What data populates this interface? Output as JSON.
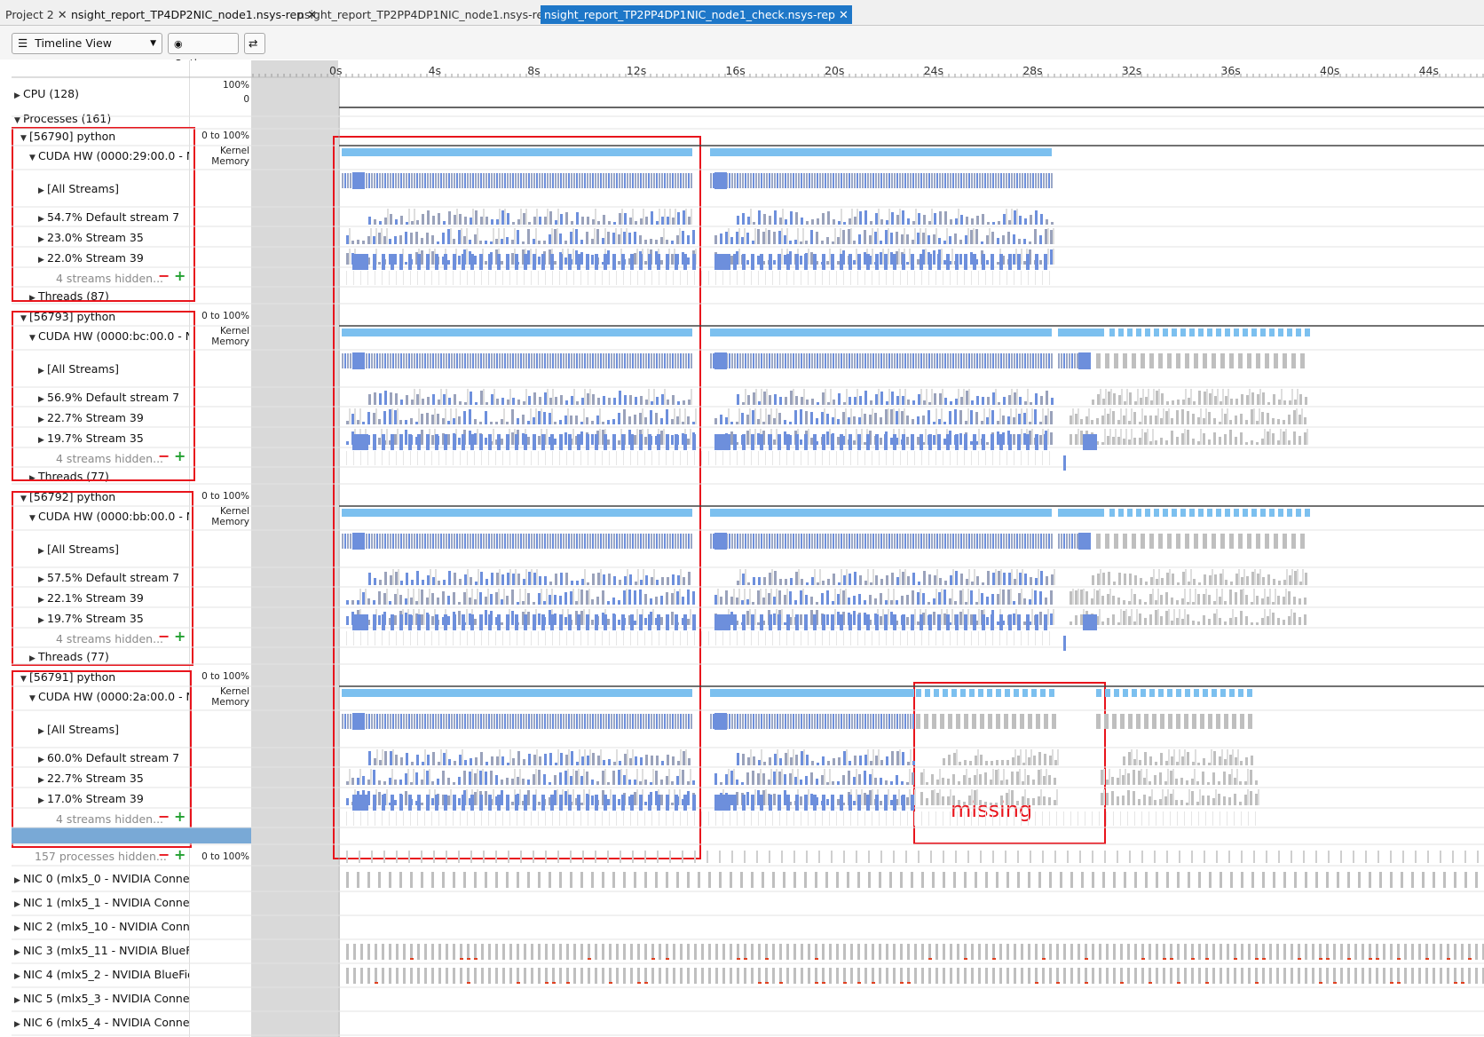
{
  "tabs": [
    {
      "label": "Project 2",
      "active": false
    },
    {
      "label": "nsight_report_TP4DP2NIC_node1.nsys-rep",
      "active": false
    },
    {
      "label": "nsight_report_TP2PP4DP1NIC_node1.nsys-rep",
      "active": false
    },
    {
      "label": "nsight_report_TP2PP4DP1NIC_node1_check.nsys-rep",
      "active": true
    }
  ],
  "toolbar": {
    "view_label": "Timeline View",
    "options_label": "Options...",
    "swap_icon": "swap-icon"
  },
  "ruler": {
    "ticks": [
      "0s",
      "4s",
      "8s",
      "12s",
      "16s",
      "20s",
      "24s",
      "28s",
      "32s",
      "36s",
      "40s",
      "44s"
    ]
  },
  "cpu": {
    "label": "CPU (128)",
    "scale_top": "100%",
    "scale_bottom": "0"
  },
  "processes_label": "Processes (161)",
  "processes": [
    {
      "label": "[56790] python",
      "range": "0 to 100%",
      "cuda": "CUDA HW (0000:29:00.0 - NVI",
      "streams": [
        "[All Streams]",
        "54.7% Default stream 7",
        "23.0% Stream 35",
        "22.0% Stream 39"
      ],
      "hidden": "4 streams hidden...",
      "threads": "Threads (87)",
      "has_tail": false,
      "has_missing": false
    },
    {
      "label": "[56793] python",
      "range": "0 to 100%",
      "cuda": "CUDA HW (0000:bc:00.0 - NVI",
      "streams": [
        "[All Streams]",
        "56.9% Default stream 7",
        "22.7% Stream 39",
        "19.7% Stream 35"
      ],
      "hidden": "4 streams hidden...",
      "threads": "Threads (77)",
      "has_tail": true,
      "has_missing": false
    },
    {
      "label": "[56792] python",
      "range": "0 to 100%",
      "cuda": "CUDA HW (0000:bb:00.0 - NVI",
      "streams": [
        "[All Streams]",
        "57.5% Default stream 7",
        "22.1% Stream 39",
        "19.7% Stream 35"
      ],
      "hidden": "4 streams hidden...",
      "threads": "Threads (77)",
      "has_tail": true,
      "has_missing": false
    },
    {
      "label": "[56791] python",
      "range": "0 to 100%",
      "cuda": "CUDA HW (0000:2a:00.0 - NVI",
      "streams": [
        "[All Streams]",
        "60.0% Default stream 7",
        "22.7% Stream 35",
        "17.0% Stream 39"
      ],
      "hidden": "4 streams hidden...",
      "threads": "Threads (79)",
      "has_tail": false,
      "has_missing": true
    }
  ],
  "kernel_label": "Kernel",
  "memory_label": "Memory",
  "processes_hidden": {
    "label": "157 processes hidden...",
    "range": "0 to 100%"
  },
  "nics": [
    "NIC 0 (mlx5_0 - NVIDIA ConnectX-",
    "NIC 1 (mlx5_1 - NVIDIA ConnectX-",
    "NIC 2 (mlx5_10 - NVIDIA ConnectX",
    "NIC 3 (mlx5_11 - NVIDIA BlueField",
    "NIC 4 (mlx5_2 - NVIDIA BlueField-3",
    "NIC 5 (mlx5_3 - NVIDIA ConnectX-",
    "NIC 6 (mlx5_4 - NVIDIA ConnectX-"
  ],
  "kernel_chip_label": "n...",
  "annotation": {
    "missing_label": "missing"
  },
  "colors": {
    "accent_blue": "#1e77c8",
    "kernel_blue": "#6d8fdc",
    "memory_blue": "#7cc0ef",
    "bar_gray": "#bfbfbf",
    "annotation_red": "#e8141c",
    "selected_row": "#79a9d6"
  }
}
